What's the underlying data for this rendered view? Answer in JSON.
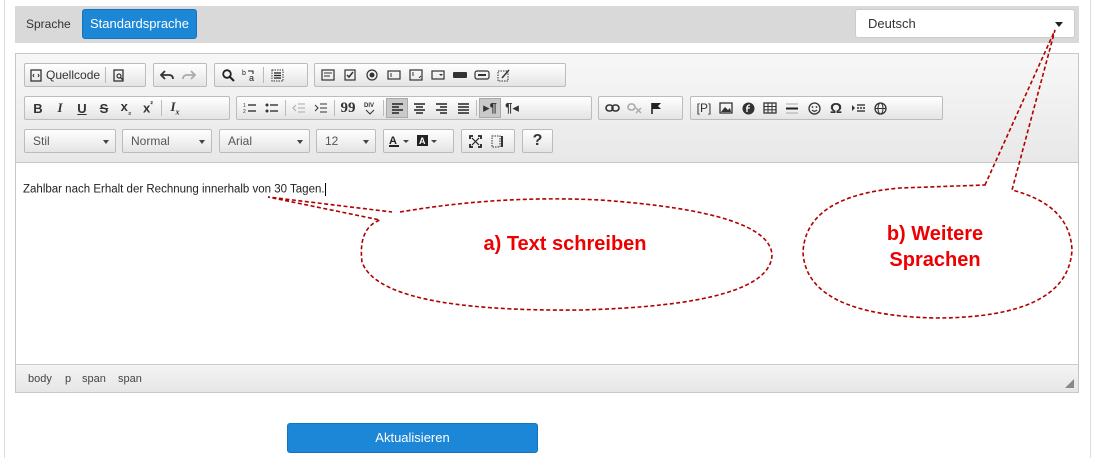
{
  "language": {
    "label": "Sprache",
    "default_button": "Standardsprache",
    "selected": "Deutsch"
  },
  "toolbar": {
    "source_label": "Quellcode",
    "style_combo": "Stil",
    "format_combo": "Normal",
    "font_combo": "Arial",
    "size_combo": "12",
    "help_label": "?",
    "quote_label": "99",
    "omega_label": "Ω",
    "placeholder_label": "[P]",
    "rtl_label": "¶"
  },
  "content": {
    "text": "Zahlbar nach Erhalt der Rechnung innerhalb von 30 Tagen."
  },
  "path": [
    "body",
    "p",
    "span",
    "span"
  ],
  "update_button": "Aktualisieren",
  "annotations": {
    "a": "a) Text schreiben",
    "b_line1": "b) Weitere",
    "b_line2": "Sprachen",
    "color": "#e00000"
  }
}
